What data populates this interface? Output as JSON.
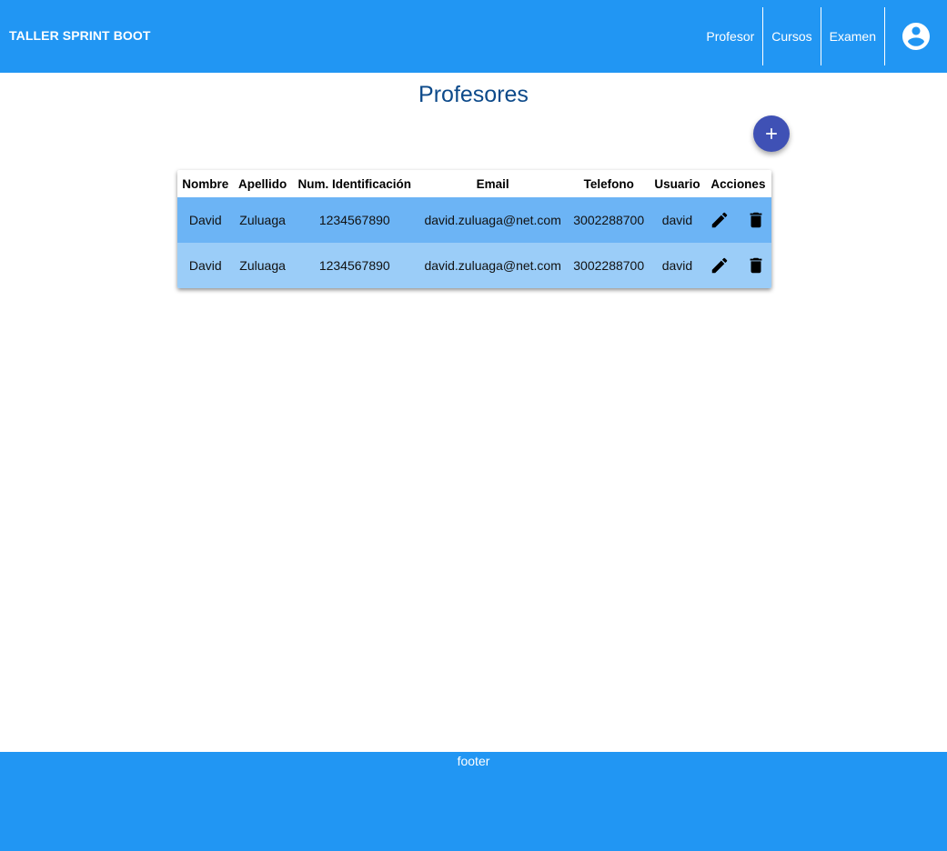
{
  "header": {
    "brand": "TALLER SPRINT BOOT",
    "nav": [
      "Profesor",
      "Cursos",
      "Examen"
    ],
    "account_icon": "account-circle-icon",
    "bg_color": "#2196f3"
  },
  "page": {
    "title": "Profesores",
    "add_icon": "plus-icon",
    "fab_color": "#3f51b5"
  },
  "table": {
    "columns": [
      "Nombre",
      "Apellido",
      "Num. Identificación",
      "Email",
      "Telefono",
      "Usuario",
      "Acciones"
    ],
    "rows": [
      [
        "David",
        "Zuluaga",
        "1234567890",
        "david.zuluaga@net.com",
        "3002288700",
        "david"
      ],
      [
        "David",
        "Zuluaga",
        "1234567890",
        "david.zuluaga@net.com",
        "3002288700",
        "david"
      ]
    ],
    "row_colors": [
      "#6cb4f5",
      "#9bcdf8"
    ],
    "edit_icon": "pencil-icon",
    "delete_icon": "trash-icon"
  },
  "footer": {
    "text": "footer"
  }
}
